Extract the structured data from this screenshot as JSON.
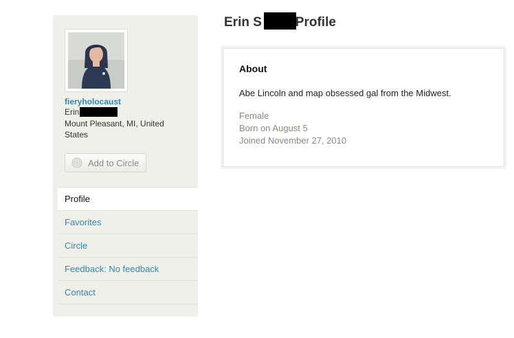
{
  "sidebar": {
    "username": "fieryholocaust",
    "real_name_visible": "Erin S",
    "location": "Mount Pleasant, MI, United States",
    "add_to_circle_label": "Add to Circle",
    "nav": {
      "profile": "Profile",
      "favorites": "Favorites",
      "circle": "Circle",
      "feedback": "Feedback: No feedback",
      "contact": "Contact"
    }
  },
  "main": {
    "title_prefix": "Erin S",
    "title_suffix": "r's Profile",
    "about": {
      "heading": "About",
      "bio": "Abe Lincoln and map obsessed gal from the Midwest.",
      "gender": "Female",
      "born": "Born on August 5",
      "joined": "Joined November 27, 2010"
    }
  },
  "colors": {
    "link": "#2b8ab8",
    "sidebar_bg": "#f0f0ea",
    "muted_text": "#8a8a80",
    "redaction": "#000000"
  },
  "icons": {
    "add_to_circle": "circle-icon"
  }
}
